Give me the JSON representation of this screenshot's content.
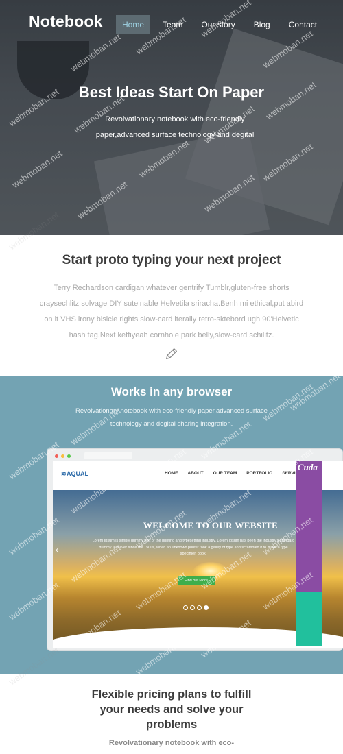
{
  "header": {
    "logo": "Notebook",
    "nav": [
      {
        "label": "Home",
        "active": true
      },
      {
        "label": "Team"
      },
      {
        "label": "Our story"
      },
      {
        "label": "Blog"
      },
      {
        "label": "Contact"
      }
    ]
  },
  "hero": {
    "title": "Best Ideas Start On Paper",
    "subtitle_line1": "Revolvationary notebook with eco-friendly",
    "subtitle_line2": "paper,advanced surface technology and degital"
  },
  "proto": {
    "title": "Start proto typing your next project",
    "body": "Terry Rechardson cardigan whatever gentrify Tumblr,gluten-free shorts craysechlitz solvage DIY suteinable Helvetila sriracha.Benh mi ethical,put abird on it VHS irony bisicle rights slow-card iterally retro-sktebord ugh 90'Helvetic hash tag.Next ketfiyeah cornhole park belly,slow-card schilitz.",
    "icon": "pencil-icon"
  },
  "browser": {
    "title": "Works in any browser",
    "desc": "Revolvationary notebook with eco-friendly paper,advanced surface technology and degital sharing integration.",
    "mock": {
      "site_logo": "AQUAL",
      "nav": [
        "HOME",
        "ABOUT",
        "OUR TEAM",
        "PORTFOLIO",
        "SERVICES"
      ],
      "banner_title": "WELCOME TO OUR WEBSITE",
      "banner_text": "Lorem Ipsum is simply dummy text of the printing and typesetting industry. Lorem Ipsum has been the industry's standard dummy text ever since the 1500s, when an unknown printer took a galley of type and scrambled it to make a type specimen book.",
      "button": "Find out More",
      "side_brand": "Cuda"
    }
  },
  "pricing": {
    "title": "Flexible pricing plans to fulfill your needs and solve your problems",
    "subtitle": "Revolvationary notebook with eco-"
  },
  "watermark": "webmoban.net",
  "colors": {
    "nav_active_bg": "#5d6b72",
    "nav_active_text": "#9fd3e4",
    "browser_bg": "#73a3b3",
    "button_green": "#3fae4c",
    "cuda_purple": "#8a4ca3",
    "cuda_teal": "#21c09d"
  }
}
